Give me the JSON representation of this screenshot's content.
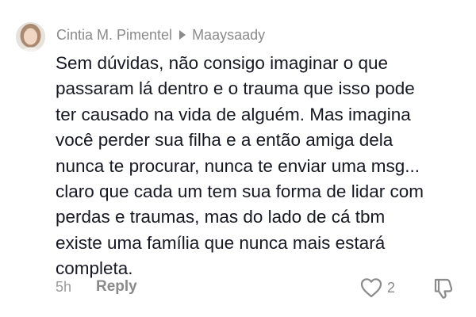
{
  "comment": {
    "author": "Cintia M. Pimentel",
    "reply_to": "Maaysaady",
    "text": "Sem dúvidas, não consigo imaginar o que\npassaram lá dentro e o trauma que isso pode\nter causado na vida de alguém. Mas imagina\nvocê perder sua filha e a então amiga dela\nnunca te procurar, nunca te enviar uma msg...\nclaro que cada um tem sua forma de lidar com\nperdas e traumas, mas do lado de cá tbm\nexiste uma família que nunca mais estará\ncompleta.",
    "time": "5h",
    "reply_label": "Reply",
    "like_count": "2",
    "icons": {
      "avatar": "user-avatar",
      "arrow": "caret-right-icon",
      "like": "heart-outline-icon",
      "dislike": "thumbs-down-icon"
    },
    "colors": {
      "text": "#161823",
      "meta": "#8a8a8a"
    }
  }
}
